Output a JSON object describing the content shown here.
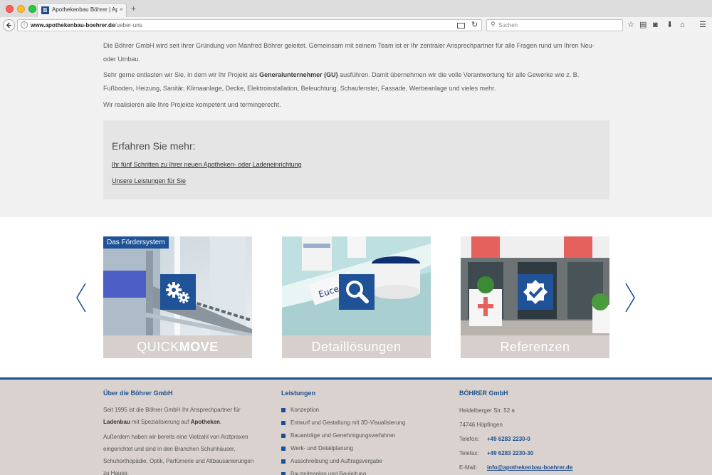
{
  "browser": {
    "tab_title": "Apothekenbau Böhrer | Apoth",
    "tab_favicon": "B",
    "tab_close": "×",
    "new_tab": "+",
    "url_domain": "www.apothekenbau-boehrer.de",
    "url_path": "/ueber-uns",
    "search_placeholder": "Suchen"
  },
  "intro": {
    "p1": "Die Böhrer GmbH wird seit ihrer Gründung von Manfred Böhrer geleitet. Gemeinsam mit seinem Team ist er Ihr zentraler Ansprechpartner für alle Fragen rund um Ihren Neu- oder Umbau.",
    "p2_a": "Sehr gerne entlasten wir Sie, in dem wir Ihr Projekt als ",
    "p2_bold": "Generalunternehmer (GU)",
    "p2_b": " ausführen. Damit übernehmen wir die volle Verantwortung für alle Gewerke wie z. B. Fußboden, Heizung, Sanitär, Klimaanlage, Decke, Elektroinstallation, Beleuchtung, Schaufenster, Fassade, Werbeanlage und vieles mehr.",
    "p3": "Wir realisieren alle Ihre Projekte kompetent und termingerecht."
  },
  "more": {
    "title": "Erfahren Sie mehr:",
    "links": [
      "Ihr fünf Schritten zu Ihrer neuen Apotheken- oder Ladeneinrichtung",
      "Unsere Leistungen für Sie"
    ]
  },
  "slider": {
    "cards": [
      {
        "tag": "Das Fördersystem",
        "caption_light": "QUICK",
        "caption_bold": "MOVE",
        "icon": "gears-icon"
      },
      {
        "caption": "Detaillösungen",
        "icon": "magnifier-icon"
      },
      {
        "caption": "Referenzen",
        "icon": "checkmark-icon"
      }
    ]
  },
  "footer": {
    "about": {
      "heading": "Über die Böhrer GmbH",
      "t1_a": "Seit 1995 ist die Böhrer GmbH Ihr Ansprechpartner für ",
      "t1_bold1": "Ladenbau",
      "t1_b": " mit Spezialisierung auf ",
      "t1_bold2": "Apotheken",
      "t1_c": ".",
      "t2": "Außerdem haben wir bereits eine Vielzahl von Arztpraxen eingerichtet und sind in den Branchen Schuhhäuser, Schuhorthopädie, Optik, Parfümerie und Altbausanierungen zu Hause."
    },
    "services": {
      "heading": "Leistungen",
      "items": [
        "Konzeption",
        "Entwurf und Gestaltung mit 3D-Visualisierung",
        "Bauanträge und Genehmigungsverfahren",
        "Werk- und Detailplanung",
        "Ausschreibung und Auftragsvergabe",
        "Bauzeitenplan und Bauleitung"
      ]
    },
    "contact": {
      "heading": "BÖHRER GmbH",
      "street": "Heidelberger Str. 52 a",
      "city": "74746 Höpfingen",
      "phone_label": "Telefon:",
      "phone": "+49 6283 2230-0",
      "fax_label": "Telefax:",
      "fax": "+49 6283 2230-30",
      "email_label": "E-Mail:",
      "email": "info@apothekenbau-boehrer.de"
    }
  },
  "colors": {
    "brand_blue": "#1f5296",
    "footer_bg": "#d9d2ce",
    "caption_bg": "#d6cfcb"
  }
}
